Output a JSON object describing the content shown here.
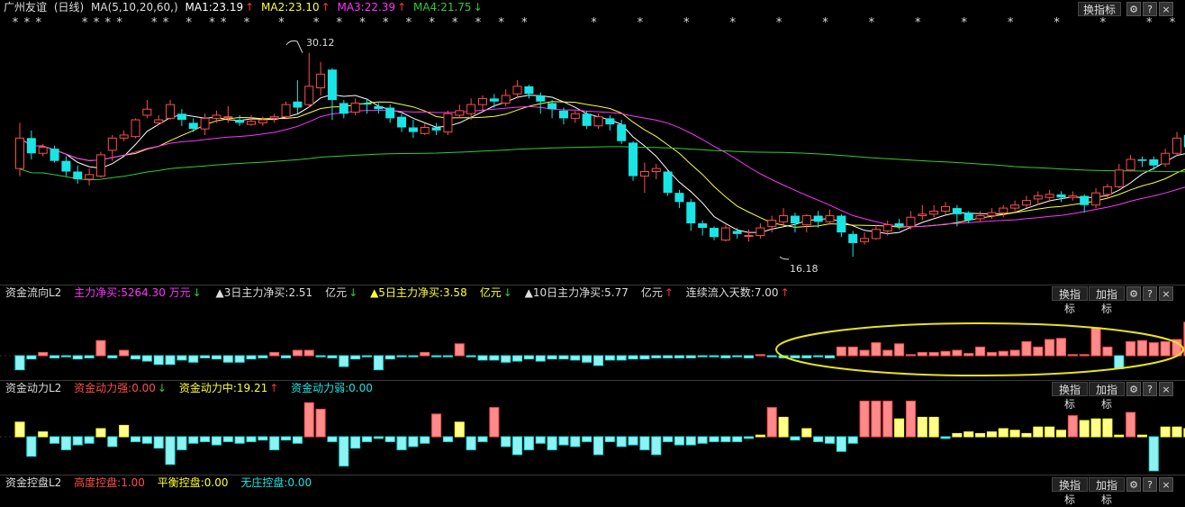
{
  "main": {
    "stock_name": "广州友谊",
    "period": "(日线)",
    "ma_label": "MA(5,10,20,60,)",
    "ma1": "MA1:23.19",
    "ma1_arrow": "↑",
    "ma2": "MA2:23.10",
    "ma2_arrow": "↑",
    "ma3": "MA3:22.39",
    "ma3_arrow": "↑",
    "ma4": "MA4:21.75",
    "ma4_arrow": "↓",
    "high_label": "30.12",
    "low_label": "16.18",
    "star_glyph": "*",
    "colors": {
      "up": "#ff4d4d",
      "down": "#19e5e5",
      "ma1": "#ffffff",
      "ma2": "#ffff33",
      "ma3": "#ff33ff",
      "ma4": "#33cc33"
    }
  },
  "buttons": {
    "switch": "换指标",
    "add": "加指标",
    "gear": "⚙",
    "help": "?",
    "close": "×"
  },
  "panel1": {
    "name": "资金流向L2",
    "main_net": "主力净买:5264.30 万元",
    "main_net_arrow": "↓",
    "d3": "▲3日主力净买:2.51",
    "d3_unit": "亿元",
    "d3_arrow": "↓",
    "d5": "▲5日主力净买:3.58",
    "d5_unit": "亿元",
    "d5_arrow": "↓",
    "d10": "▲10日主力净买:5.77",
    "d10_unit": "亿元",
    "d10_arrow": "↑",
    "days": "连续流入天数:7.00",
    "days_arrow": "↑"
  },
  "panel2": {
    "name": "资金动力L2",
    "strong": "资金动力强:0.00",
    "strong_arrow": "↓",
    "mid": "资金动力中:19.21",
    "mid_arrow": "↑",
    "weak": "资金动力弱:0.00"
  },
  "panel3": {
    "name": "资金控盘L2",
    "high": "高度控盘:1.00",
    "balance": "平衡控盘:0.00",
    "none": "无庄控盘:0.00"
  },
  "chart_data": [
    {
      "type": "candlestick",
      "title": "广州友谊 (日线)",
      "ylim": [
        15.5,
        31
      ],
      "series": [
        {
          "name": "MA1",
          "value": 23.19
        },
        {
          "name": "MA2",
          "value": 23.1
        },
        {
          "name": "MA3",
          "value": 22.39
        },
        {
          "name": "MA4",
          "value": 21.75
        }
      ],
      "annotations": [
        "30.12",
        "16.18"
      ],
      "candles": [
        [
          22,
          24,
          25,
          21.5
        ],
        [
          24,
          23,
          24.5,
          22.6
        ],
        [
          23,
          23.4,
          23.6,
          22.8
        ],
        [
          23.3,
          22.5,
          23.5,
          22.4
        ],
        [
          22.5,
          21.8,
          22.8,
          21.5
        ],
        [
          21.8,
          21.3,
          22.2,
          21
        ],
        [
          21.3,
          21.6,
          22,
          20.9
        ],
        [
          21.5,
          22.9,
          23.1,
          21.4
        ],
        [
          23.2,
          24,
          24.2,
          22.5
        ],
        [
          24,
          24.2,
          24.5,
          23.8
        ],
        [
          24.1,
          25.2,
          25.3,
          24
        ],
        [
          25.5,
          25.9,
          26.5,
          25.3
        ],
        [
          25,
          25.2,
          25.5,
          24.9
        ],
        [
          25.3,
          26.2,
          26.5,
          25.2
        ],
        [
          25.6,
          25.2,
          25.9,
          24.8
        ],
        [
          25,
          24.6,
          25.3,
          24.4
        ],
        [
          24.6,
          25.3,
          25.6,
          24.2
        ],
        [
          25.3,
          25.5,
          25.8,
          25
        ],
        [
          25.4,
          25.4,
          26.1,
          25
        ],
        [
          25.2,
          25,
          25.5,
          24.8
        ],
        [
          24.9,
          25.1,
          25.5,
          24.8
        ],
        [
          25,
          25.2,
          25.4,
          24.8
        ],
        [
          25.3,
          25.4,
          25.6,
          25
        ],
        [
          25.4,
          26.2,
          26.4,
          25.3
        ],
        [
          26.4,
          26,
          27.8,
          25.6
        ],
        [
          26.2,
          27.4,
          29.6,
          26
        ],
        [
          27.3,
          28.2,
          29,
          26.8
        ],
        [
          28.5,
          26.5,
          28.6,
          25.2
        ],
        [
          26.3,
          25.6,
          26.5,
          25.3
        ],
        [
          25.7,
          26.3,
          26.6,
          25.5
        ],
        [
          26.3,
          26.2,
          26.6,
          25.6
        ],
        [
          26.1,
          25.9,
          26.3,
          25.6
        ],
        [
          26,
          25.3,
          26.2,
          25
        ],
        [
          25.4,
          24.7,
          25.6,
          24.4
        ],
        [
          24.7,
          24.4,
          25.2,
          24
        ],
        [
          24.3,
          24.7,
          25,
          24.2
        ],
        [
          24.7,
          24.5,
          25,
          24.2
        ],
        [
          24.4,
          25.6,
          25.8,
          24.2
        ],
        [
          25.5,
          25.8,
          26.2,
          25.3
        ],
        [
          25.6,
          26.2,
          26.6,
          25.2
        ],
        [
          26.2,
          26.6,
          26.8,
          25.8
        ],
        [
          26.6,
          26.4,
          26.9,
          26
        ],
        [
          26.3,
          26.8,
          27.2,
          26.1
        ],
        [
          26.9,
          27.4,
          27.8,
          26.6
        ],
        [
          27.4,
          26.9,
          27.5,
          26.6
        ],
        [
          26.8,
          26.4,
          27,
          25.6
        ],
        [
          26.3,
          25.9,
          26.5,
          25.3
        ],
        [
          25.8,
          25.3,
          26,
          24.9
        ],
        [
          25.3,
          25.6,
          25.8,
          25
        ],
        [
          25.6,
          24.8,
          25.8,
          24.6
        ],
        [
          24.8,
          25.4,
          25.6,
          24.6
        ],
        [
          25.3,
          24.9,
          25.5,
          24.5
        ],
        [
          24.9,
          23.8,
          25.2,
          23.6
        ],
        [
          23.7,
          21.5,
          23.8,
          21.2
        ],
        [
          21.5,
          21.8,
          22.4,
          20.4
        ],
        [
          21.8,
          22,
          22.3,
          21.3
        ],
        [
          21.8,
          20.4,
          21.9,
          20.2
        ],
        [
          20.4,
          19.8,
          20.6,
          19.4
        ],
        [
          19.8,
          18.4,
          20,
          17.9
        ],
        [
          18.4,
          18.1,
          18.6,
          17.6
        ],
        [
          18.1,
          17.5,
          18.2,
          17.3
        ],
        [
          17.3,
          18.1,
          18.3,
          17.2
        ],
        [
          17.9,
          17.7,
          18.1,
          17.4
        ],
        [
          17.6,
          17.6,
          18,
          17.2
        ],
        [
          17.6,
          18.1,
          18.4,
          17.4
        ],
        [
          18.2,
          18.6,
          18.9,
          17.8
        ],
        [
          18.5,
          18.9,
          19.4,
          18.3
        ],
        [
          18.9,
          18.4,
          19.1,
          17.8
        ],
        [
          18.3,
          18.9,
          19,
          17.8
        ],
        [
          18.9,
          18.5,
          19.2,
          18.1
        ],
        [
          18.5,
          18.9,
          19.3,
          18.3
        ],
        [
          18.9,
          17.8,
          19,
          17.5
        ],
        [
          17.7,
          17.1,
          17.9,
          16.2
        ],
        [
          17.2,
          17.4,
          17.8,
          17
        ],
        [
          17.4,
          18,
          18.3,
          17.3
        ],
        [
          17.9,
          18.3,
          18.6,
          17.6
        ],
        [
          18.4,
          18.2,
          18.7,
          18
        ],
        [
          18.2,
          18.8,
          19.2,
          18
        ],
        [
          18.9,
          19,
          19.6,
          18.6
        ],
        [
          19.0,
          19.2,
          19.6,
          18.8
        ],
        [
          19.2,
          19.5,
          19.8,
          19
        ],
        [
          19.4,
          19,
          19.6,
          18.2
        ],
        [
          19.1,
          18.6,
          19.2,
          18.4
        ],
        [
          18.7,
          18.9,
          19.2,
          18.5
        ],
        [
          18.9,
          19.1,
          19.4,
          18.7
        ],
        [
          19.1,
          19.4,
          19.6,
          18.8
        ],
        [
          19.4,
          19.6,
          19.9,
          19.2
        ],
        [
          19.6,
          19.9,
          20.2,
          19.4
        ],
        [
          20,
          20.2,
          20.5,
          19.6
        ],
        [
          20.1,
          20.3,
          20.6,
          19.8
        ],
        [
          20.3,
          20.1,
          20.5,
          19.8
        ],
        [
          20.1,
          20.2,
          20.5,
          19.9
        ],
        [
          20.2,
          19.6,
          20.3,
          19.1
        ],
        [
          19.6,
          20.4,
          20.7,
          19.4
        ],
        [
          20.3,
          20.8,
          21,
          20
        ],
        [
          20.8,
          21.9,
          22.3,
          20.7
        ],
        [
          21.9,
          22.6,
          22.9,
          21.8
        ],
        [
          22.6,
          22.5,
          22.8,
          22.1
        ],
        [
          22.6,
          22.2,
          22.8,
          21.9
        ],
        [
          22.3,
          23,
          23.3,
          22.1
        ],
        [
          23,
          24,
          24.4,
          22.8
        ],
        [
          24.2,
          23.4,
          24.3,
          23.1
        ],
        [
          23.5,
          22.6,
          23.6,
          22.3
        ],
        [
          22.6,
          22.4,
          22.8,
          21.2
        ],
        [
          22.5,
          22.6,
          22.9,
          22.2
        ],
        [
          22.6,
          22.8,
          23.1,
          22.4
        ],
        [
          22.8,
          22.5,
          23,
          22.2
        ],
        [
          22.4,
          22.9,
          23.2,
          22.3
        ],
        [
          23,
          22.8,
          23.2,
          22.6
        ],
        [
          22.9,
          23.5,
          23.7,
          22.7
        ],
        [
          23.5,
          23.7,
          23.9,
          23.4
        ]
      ]
    },
    {
      "type": "bar",
      "title": "资金流向L2",
      "values": [
        -1.3,
        -0.3,
        0.3,
        -0.2,
        -0.1,
        -0.3,
        -0.2,
        1.4,
        -0.2,
        0.5,
        -0.3,
        -0.5,
        -0.8,
        -0.8,
        -0.4,
        -0.6,
        -0.2,
        -0.3,
        -0.6,
        -0.6,
        -0.3,
        -0.2,
        0.3,
        -0.2,
        0.5,
        0.5,
        -0.1,
        -0.2,
        -1,
        -0.3,
        -0.1,
        -1.3,
        -0.3,
        -0.1,
        -0.1,
        0.3,
        -0.1,
        -0.1,
        1.1,
        -0.1,
        -0.4,
        -0.4,
        -0.6,
        -0.5,
        -0.3,
        -0.5,
        -0.3,
        -0.3,
        -0.4,
        -0.6,
        -0.9,
        -0.4,
        -0.4,
        -0.3,
        -0.3,
        -0.2,
        -0.2,
        -0.2,
        -0.2,
        -0.1,
        -0.1,
        -0.2,
        -0.1,
        -0.2,
        0.1,
        -0.1,
        -0.2,
        -0.2,
        -0.2,
        -0.1,
        -0.2,
        0.8,
        0.8,
        0.5,
        1.2,
        0.5,
        1.1,
        0.1,
        0.3,
        0.3,
        0.4,
        0.5,
        0.2,
        0.8,
        0.3,
        0.4,
        0.5,
        1.3,
        0.8,
        1.5,
        1.6,
        0.1,
        0.1,
        2.6,
        0.8,
        -1.2,
        1.3,
        1.4,
        1.2,
        1.3,
        1.5,
        3.1,
        1.2
      ]
    },
    {
      "type": "bar",
      "title": "资金动力L2",
      "values": [
        0.9,
        -1.2,
        0.3,
        -0.4,
        -0.8,
        -0.5,
        -0.4,
        0.5,
        -0.6,
        0.7,
        -0.3,
        -0.4,
        -0.7,
        -1.7,
        -0.8,
        -0.4,
        -0.3,
        -0.5,
        -0.3,
        -0.4,
        -0.3,
        -0.2,
        -0.8,
        -0.2,
        -0.4,
        2.1,
        1.7,
        -0.3,
        -1.8,
        -0.7,
        -0.3,
        -0.1,
        -0.3,
        -0.8,
        -0.6,
        -0.4,
        1.4,
        -0.3,
        0.9,
        -0.8,
        -0.3,
        1.8,
        -0.6,
        -1.1,
        -0.8,
        -0.4,
        -0.8,
        -0.5,
        -0.6,
        -0.3,
        -1.1,
        -0.3,
        -0.6,
        -0.5,
        -0.8,
        -1.1,
        -0.3,
        -0.5,
        -0.5,
        -0.4,
        -0.3,
        -0.3,
        -0.3,
        -0.1,
        0.1,
        1.8,
        1.2,
        -0.2,
        0.5,
        -0.3,
        -0.4,
        -0.9,
        -0.4,
        2.2,
        2.2,
        2.2,
        1.1,
        2.2,
        1.2,
        1.2,
        -0.1,
        0.2,
        0.3,
        0.2,
        0.3,
        0.5,
        0.4,
        0.2,
        0.6,
        0.6,
        0.4,
        1.3,
        1,
        1.1,
        1.1,
        0.1,
        1.5,
        0.1,
        -2.1,
        0.6,
        0.6,
        0.5,
        0.6,
        0.7,
        1.2,
        0.5
      ]
    }
  ]
}
